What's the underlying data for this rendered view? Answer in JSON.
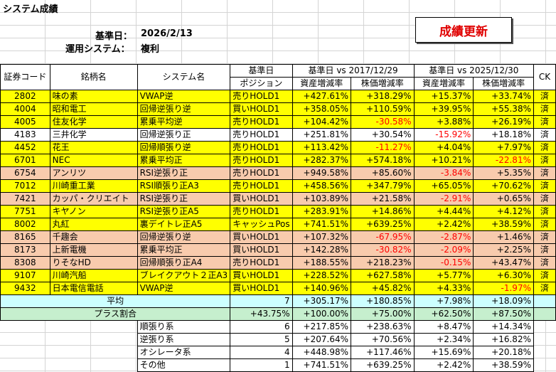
{
  "title": "システム成績",
  "base_date_label": "基準日：",
  "base_date": "2026/2/13",
  "system_label": "運用システム：",
  "system_value": "複利",
  "refresh_button": "成績更新",
  "headers": {
    "code": "証券コード",
    "name": "銘柄名",
    "system": "システム名",
    "base_top": "基準日",
    "position": "ポジション",
    "group1": "基準日 vs 2017/12/29",
    "group2": "基準日 vs 2025/12/30",
    "asset": "資産増減率",
    "price": "株価増減率",
    "ck": "CK"
  },
  "rows": [
    {
      "code": "2802",
      "name": "味の素",
      "system": "VWAP逆",
      "position": "売りHOLD1",
      "a1": "+427.61%",
      "p1": "+318.29%",
      "a2": "+15.37%",
      "p2": "+33.74%",
      "ck": "済",
      "color": "y",
      "neg": []
    },
    {
      "code": "4004",
      "name": "昭和電工",
      "system": "回帰逆張り逆",
      "position": "買いHOLD1",
      "a1": "+358.05%",
      "p1": "+110.59%",
      "a2": "+39.95%",
      "p2": "+55.38%",
      "ck": "済",
      "color": "y",
      "neg": []
    },
    {
      "code": "4005",
      "name": "住友化学",
      "system": "累乗平均逆",
      "position": "売りHOLD1",
      "a1": "+104.42%",
      "p1": "-30.58%",
      "a2": "+3.88%",
      "p2": "+26.19%",
      "ck": "済",
      "color": "y",
      "neg": [
        "p1"
      ]
    },
    {
      "code": "4183",
      "name": "三井化学",
      "system": "回帰逆張り正",
      "position": "売りHOLD1",
      "a1": "+251.81%",
      "p1": "+30.54%",
      "a2": "-15.92%",
      "p2": "+18.18%",
      "ck": "済",
      "color": "w",
      "neg": [
        "a2"
      ]
    },
    {
      "code": "4452",
      "name": "花王",
      "system": "回帰順張り逆",
      "position": "売りHOLD1",
      "a1": "+113.42%",
      "p1": "-11.27%",
      "a2": "+4.04%",
      "p2": "+7.97%",
      "ck": "済",
      "color": "y",
      "neg": [
        "p1"
      ]
    },
    {
      "code": "6701",
      "name": "NEC",
      "system": "累乗平均正",
      "position": "売りHOLD1",
      "a1": "+282.37%",
      "p1": "+574.18%",
      "a2": "+10.21%",
      "p2": "-22.81%",
      "ck": "済",
      "color": "y",
      "neg": [
        "p2"
      ]
    },
    {
      "code": "6754",
      "name": "アンリツ",
      "system": "RSI逆張り正",
      "position": "売りHOLD1",
      "a1": "+949.58%",
      "p1": "+85.60%",
      "a2": "-3.84%",
      "p2": "+5.35%",
      "ck": "済",
      "color": "o",
      "neg": [
        "a2"
      ]
    },
    {
      "code": "7012",
      "name": "川崎重工業",
      "system": "RSI順張り正A3",
      "position": "売りHOLD1",
      "a1": "+458.56%",
      "p1": "+347.79%",
      "a2": "+65.05%",
      "p2": "+70.62%",
      "ck": "済",
      "color": "y",
      "neg": []
    },
    {
      "code": "7421",
      "name": "カッパ・クリエイト",
      "system": "RSI逆張り正",
      "position": "買いHOLD1",
      "a1": "+103.89%",
      "p1": "+21.58%",
      "a2": "-2.91%",
      "p2": "+0.65%",
      "ck": "済",
      "color": "o",
      "neg": [
        "a2"
      ]
    },
    {
      "code": "7751",
      "name": "キヤノン",
      "system": "RSI逆張り正A5",
      "position": "売りHOLD1",
      "a1": "+283.91%",
      "p1": "+14.86%",
      "a2": "+4.44%",
      "p2": "+4.12%",
      "ck": "済",
      "color": "y",
      "neg": []
    },
    {
      "code": "8002",
      "name": "丸紅",
      "system": "裏デイトレ正A5",
      "position": "キャッシュPos",
      "a1": "+741.51%",
      "p1": "+639.25%",
      "a2": "+2.42%",
      "p2": "+38.59%",
      "ck": "済",
      "color": "y",
      "neg": []
    },
    {
      "code": "8165",
      "name": "千趣会",
      "system": "回帰逆張り逆",
      "position": "買いHOLD1",
      "a1": "+107.32%",
      "p1": "-67.95%",
      "a2": "-2.87%",
      "p2": "+1.46%",
      "ck": "済",
      "color": "o",
      "neg": [
        "p1",
        "a2"
      ]
    },
    {
      "code": "8173",
      "name": "上新電機",
      "system": "累乗平均正",
      "position": "買いHOLD1",
      "a1": "+142.28%",
      "p1": "-30.82%",
      "a2": "-2.09%",
      "p2": "+2.25%",
      "ck": "済",
      "color": "o",
      "neg": [
        "p1",
        "a2"
      ]
    },
    {
      "code": "8308",
      "name": "りそなHD",
      "system": "回帰順張り正A4",
      "position": "売りHOLD1",
      "a1": "+188.55%",
      "p1": "+218.23%",
      "a2": "-0.15%",
      "p2": "+43.47%",
      "ck": "済",
      "color": "o",
      "neg": [
        "a2"
      ]
    },
    {
      "code": "9107",
      "name": "川崎汽船",
      "system": "ブレイクアウト２正A3",
      "position": "買いHOLD1",
      "a1": "+228.52%",
      "p1": "+627.58%",
      "a2": "+5.77%",
      "p2": "+6.30%",
      "ck": "済",
      "color": "y",
      "neg": []
    },
    {
      "code": "9432",
      "name": "日本電信電話",
      "system": "VWAP逆",
      "position": "買いHOLD1",
      "a1": "+140.96%",
      "p1": "+45.82%",
      "a2": "+4.33%",
      "p2": "-1.97%",
      "ck": "済",
      "color": "y",
      "neg": [
        "p2"
      ]
    }
  ],
  "average": {
    "label": "平均",
    "count": "7",
    "a1": "+305.17%",
    "p1": "+180.85%",
    "a2": "+7.98%",
    "p2": "+18.09%"
  },
  "plus_ratio": {
    "label": "プラス割合",
    "count": "+43.75%",
    "a1": "+100.00%",
    "p1": "+75.00%",
    "a2": "+62.50%",
    "p2": "+87.50%"
  },
  "categories": [
    {
      "label": "順張り系",
      "count": "6",
      "a1": "+217.85%",
      "p1": "+238.63%",
      "a2": "+8.47%",
      "p2": "+14.34%"
    },
    {
      "label": "逆張り系",
      "count": "5",
      "a1": "+207.64%",
      "p1": "+70.56%",
      "a2": "+2.34%",
      "p2": "+16.82%"
    },
    {
      "label": "オシレータ系",
      "count": "4",
      "a1": "+448.98%",
      "p1": "+117.46%",
      "a2": "+15.69%",
      "p2": "+20.18%"
    },
    {
      "label": "その他",
      "count": "1",
      "a1": "+741.51%",
      "p1": "+639.25%",
      "a2": "+2.42%",
      "p2": "+38.59%"
    }
  ]
}
